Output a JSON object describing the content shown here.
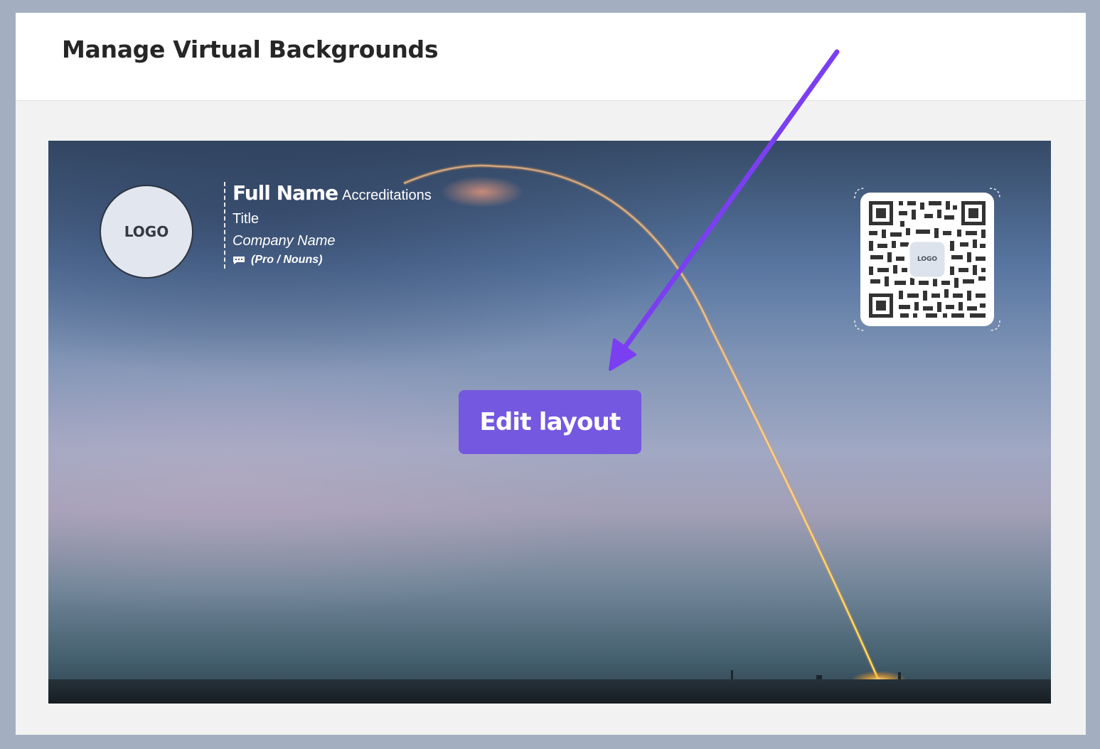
{
  "header": {
    "title": "Manage Virtual Backgrounds"
  },
  "preview": {
    "logo_label": "LOGO",
    "full_name": "Full Name",
    "accreditations": "Accreditations",
    "title": "Title",
    "company": "Company Name",
    "pronouns": "(Pro / Nouns)",
    "qr_logo_label": "LOGO",
    "edit_button_label": "Edit layout"
  },
  "icons": {
    "pronouns_icon": "speech-bubble-icon",
    "annotation": "arrow-icon"
  },
  "colors": {
    "accent": "#7458e0",
    "annotation_arrow": "#7b3ff2",
    "trail": "#ffc04d"
  }
}
